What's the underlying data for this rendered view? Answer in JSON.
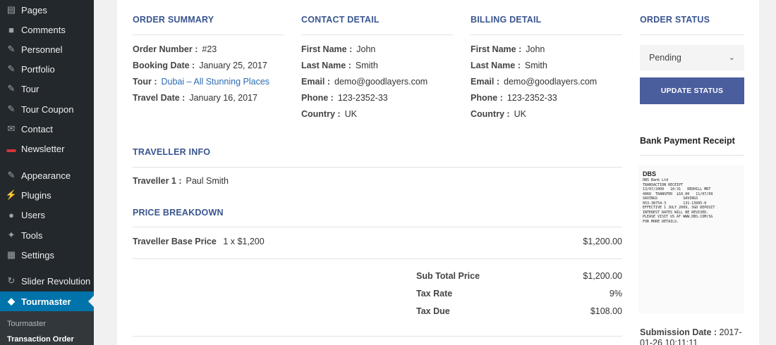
{
  "sidebar": {
    "items": [
      {
        "label": "Pages",
        "icon": "pages-icon"
      },
      {
        "label": "Comments",
        "icon": "comments-icon"
      },
      {
        "label": "Personnel",
        "icon": "pin-icon"
      },
      {
        "label": "Portfolio",
        "icon": "pin-icon"
      },
      {
        "label": "Tour",
        "icon": "pin-icon"
      },
      {
        "label": "Tour Coupon",
        "icon": "pin-icon"
      },
      {
        "label": "Contact",
        "icon": "envelope-icon"
      },
      {
        "label": "Newsletter",
        "icon": "newsletter-icon"
      },
      {
        "label": "Appearance",
        "icon": "paintbrush-icon"
      },
      {
        "label": "Plugins",
        "icon": "plugin-icon"
      },
      {
        "label": "Users",
        "icon": "user-icon"
      },
      {
        "label": "Tools",
        "icon": "wrench-icon"
      },
      {
        "label": "Settings",
        "icon": "settings-icon"
      },
      {
        "label": "Slider Revolution",
        "icon": "refresh-icon"
      },
      {
        "label": "Tourmaster",
        "icon": "tourmaster-icon"
      }
    ],
    "submenu": {
      "item1": "Tourmaster",
      "item2": "Transaction Order"
    }
  },
  "order_summary": {
    "title": "ORDER SUMMARY",
    "order_number_label": "Order Number :",
    "order_number": "#23",
    "booking_date_label": "Booking Date :",
    "booking_date": "January 25, 2017",
    "tour_label": "Tour :",
    "tour": "Dubai – All Stunning Places",
    "travel_date_label": "Travel Date :",
    "travel_date": "January 16, 2017"
  },
  "contact_detail": {
    "title": "CONTACT DETAIL",
    "first_name_label": "First Name :",
    "first_name": "John",
    "last_name_label": "Last Name :",
    "last_name": "Smith",
    "email_label": "Email :",
    "email": "demo@goodlayers.com",
    "phone_label": "Phone :",
    "phone": "123-2352-33",
    "country_label": "Country :",
    "country": "UK"
  },
  "billing_detail": {
    "title": "BILLING DETAIL",
    "first_name_label": "First Name :",
    "first_name": "John",
    "last_name_label": "Last Name :",
    "last_name": "Smith",
    "email_label": "Email :",
    "email": "demo@goodlayers.com",
    "phone_label": "Phone :",
    "phone": "123-2352-33",
    "country_label": "Country :",
    "country": "UK"
  },
  "traveller_info": {
    "title": "TRAVELLER INFO",
    "traveller1_label": "Traveller 1 :",
    "traveller1": "Paul Smith"
  },
  "price_breakdown": {
    "title": "PRICE BREAKDOWN",
    "base_label": "Traveller Base Price",
    "base_qty": "1 x $1,200",
    "base_amount": "$1,200.00",
    "subtotal_label": "Sub Total Price",
    "subtotal": "$1,200.00",
    "tax_rate_label": "Tax Rate",
    "tax_rate": "9%",
    "tax_due_label": "Tax Due",
    "tax_due": "$108.00"
  },
  "order_status": {
    "title": "ORDER STATUS",
    "selected": "Pending",
    "button": "UPDATE STATUS",
    "receipt_title": "Bank Payment Receipt",
    "submission_label": "Submission Date :",
    "submission_date": "2017-01-26 10:11:11"
  },
  "receipt": {
    "logo": "DBS",
    "lines": [
      "DBS Bank Ltd",
      "TRANSACTION RECEIPT",
      "13/07/2009   10:31   REDHILL MRT",
      "4060  TRANSFER  $10.00   11/07/09",
      "SAVINGS            SAVINGS",
      "053-38754-3        131-13995-0",
      "",
      "EFFECTIVE 1 JULY 2009, SGD DEPOSIT",
      "INTEREST RATES WILL BE REVISED.",
      "",
      "PLEASE VISIT US AT WWW.DBS.COM/SG",
      "FOR MORE DETAILS."
    ]
  },
  "colors": {
    "accent": "#3a5590",
    "button": "#4a5d9d",
    "sidebar": "#23282d",
    "active": "#0073aa"
  }
}
